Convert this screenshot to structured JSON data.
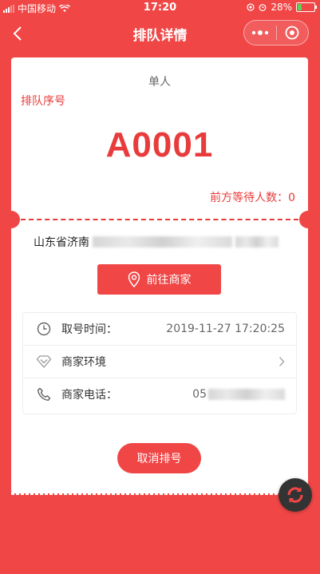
{
  "status_bar": {
    "carrier": "中国移动",
    "time": "17:20",
    "battery": "28%"
  },
  "nav": {
    "title": "排队详情"
  },
  "ticket": {
    "type": "单人",
    "label": "排队序号",
    "number": "A0001",
    "ahead": "前方等待人数：0"
  },
  "address": {
    "text": "山东省济南"
  },
  "goto_button": {
    "label": "前往商家"
  },
  "info": {
    "time_label": "取号时间：",
    "time_value": "2019-11-27 17:20:25",
    "env_label": "商家环境",
    "phone_label": "商家电话：",
    "phone_value": "05"
  },
  "cancel_button": {
    "label": "取消排号"
  },
  "colors": {
    "primary": "#f04646",
    "accent_text": "#e83b3b"
  }
}
